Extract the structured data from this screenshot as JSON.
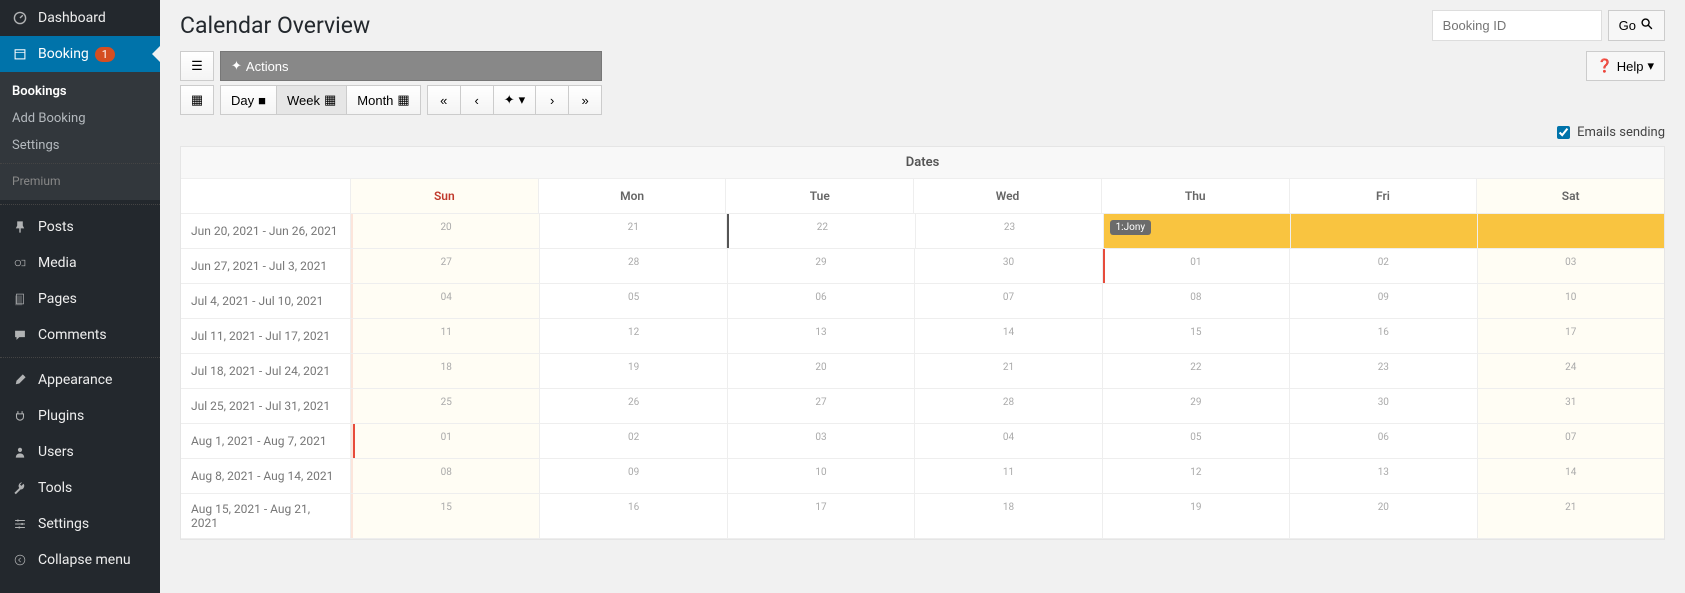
{
  "sidebar": {
    "items": [
      {
        "label": "Dashboard",
        "icon": "dashboard"
      },
      {
        "label": "Booking",
        "icon": "calendar",
        "badge": "1",
        "active": true
      },
      {
        "label": "Posts",
        "icon": "pin"
      },
      {
        "label": "Media",
        "icon": "media"
      },
      {
        "label": "Pages",
        "icon": "pages"
      },
      {
        "label": "Comments",
        "icon": "comment"
      },
      {
        "label": "Appearance",
        "icon": "brush"
      },
      {
        "label": "Plugins",
        "icon": "plug"
      },
      {
        "label": "Users",
        "icon": "user"
      },
      {
        "label": "Tools",
        "icon": "wrench"
      },
      {
        "label": "Settings",
        "icon": "sliders"
      },
      {
        "label": "Collapse menu",
        "icon": "collapse"
      }
    ],
    "sub": {
      "items": [
        {
          "label": "Bookings",
          "current": true
        },
        {
          "label": "Add Booking"
        },
        {
          "label": "Settings"
        }
      ],
      "section": "Premium"
    }
  },
  "page": {
    "title": "Calendar Overview"
  },
  "search": {
    "placeholder": "Booking ID",
    "go": "Go"
  },
  "toolbar": {
    "actions": "Actions",
    "view": {
      "day": "Day",
      "week": "Week",
      "month": "Month"
    },
    "help": "Help"
  },
  "emails": {
    "label": "Emails sending",
    "checked": true
  },
  "calendar": {
    "header": "Dates",
    "dow": [
      "Sun",
      "Mon",
      "Tue",
      "Wed",
      "Thu",
      "Fri",
      "Sat"
    ],
    "rows": [
      {
        "label": "Jun 20, 2021 - Jun 26, 2021",
        "days": [
          {
            "n": "20",
            "sun": true
          },
          {
            "n": "21"
          },
          {
            "n": "22",
            "today": true
          },
          {
            "n": "23"
          },
          {
            "n": "",
            "booked": true,
            "tag": "1:Jony"
          },
          {
            "n": "",
            "booked": true
          },
          {
            "n": "",
            "booked": true,
            "sat": true
          }
        ]
      },
      {
        "label": "Jun 27, 2021 - Jul 3, 2021",
        "days": [
          {
            "n": "27",
            "sun": true
          },
          {
            "n": "28"
          },
          {
            "n": "29"
          },
          {
            "n": "30"
          },
          {
            "n": "01",
            "redline": true
          },
          {
            "n": "02"
          },
          {
            "n": "03",
            "sat": true
          }
        ]
      },
      {
        "label": "Jul 4, 2021 - Jul 10, 2021",
        "days": [
          {
            "n": "04",
            "sun": true
          },
          {
            "n": "05"
          },
          {
            "n": "06"
          },
          {
            "n": "07"
          },
          {
            "n": "08"
          },
          {
            "n": "09"
          },
          {
            "n": "10",
            "sat": true
          }
        ]
      },
      {
        "label": "Jul 11, 2021 - Jul 17, 2021",
        "days": [
          {
            "n": "11",
            "sun": true
          },
          {
            "n": "12"
          },
          {
            "n": "13"
          },
          {
            "n": "14"
          },
          {
            "n": "15"
          },
          {
            "n": "16"
          },
          {
            "n": "17",
            "sat": true
          }
        ]
      },
      {
        "label": "Jul 18, 2021 - Jul 24, 2021",
        "days": [
          {
            "n": "18",
            "sun": true
          },
          {
            "n": "19"
          },
          {
            "n": "20"
          },
          {
            "n": "21"
          },
          {
            "n": "22"
          },
          {
            "n": "23"
          },
          {
            "n": "24",
            "sat": true
          }
        ]
      },
      {
        "label": "Jul 25, 2021 - Jul 31, 2021",
        "days": [
          {
            "n": "25",
            "sun": true
          },
          {
            "n": "26"
          },
          {
            "n": "27"
          },
          {
            "n": "28"
          },
          {
            "n": "29"
          },
          {
            "n": "30"
          },
          {
            "n": "31",
            "sat": true
          }
        ]
      },
      {
        "label": "Aug 1, 2021 - Aug 7, 2021",
        "days": [
          {
            "n": "01",
            "sun": true,
            "redline": true
          },
          {
            "n": "02"
          },
          {
            "n": "03"
          },
          {
            "n": "04"
          },
          {
            "n": "05"
          },
          {
            "n": "06"
          },
          {
            "n": "07",
            "sat": true
          }
        ]
      },
      {
        "label": "Aug 8, 2021 - Aug 14, 2021",
        "days": [
          {
            "n": "08",
            "sun": true
          },
          {
            "n": "09"
          },
          {
            "n": "10"
          },
          {
            "n": "11"
          },
          {
            "n": "12"
          },
          {
            "n": "13"
          },
          {
            "n": "14",
            "sat": true
          }
        ]
      },
      {
        "label": "Aug 15, 2021 - Aug 21, 2021",
        "days": [
          {
            "n": "15",
            "sun": true
          },
          {
            "n": "16"
          },
          {
            "n": "17"
          },
          {
            "n": "18"
          },
          {
            "n": "19"
          },
          {
            "n": "20"
          },
          {
            "n": "21",
            "sat": true
          }
        ]
      }
    ]
  }
}
